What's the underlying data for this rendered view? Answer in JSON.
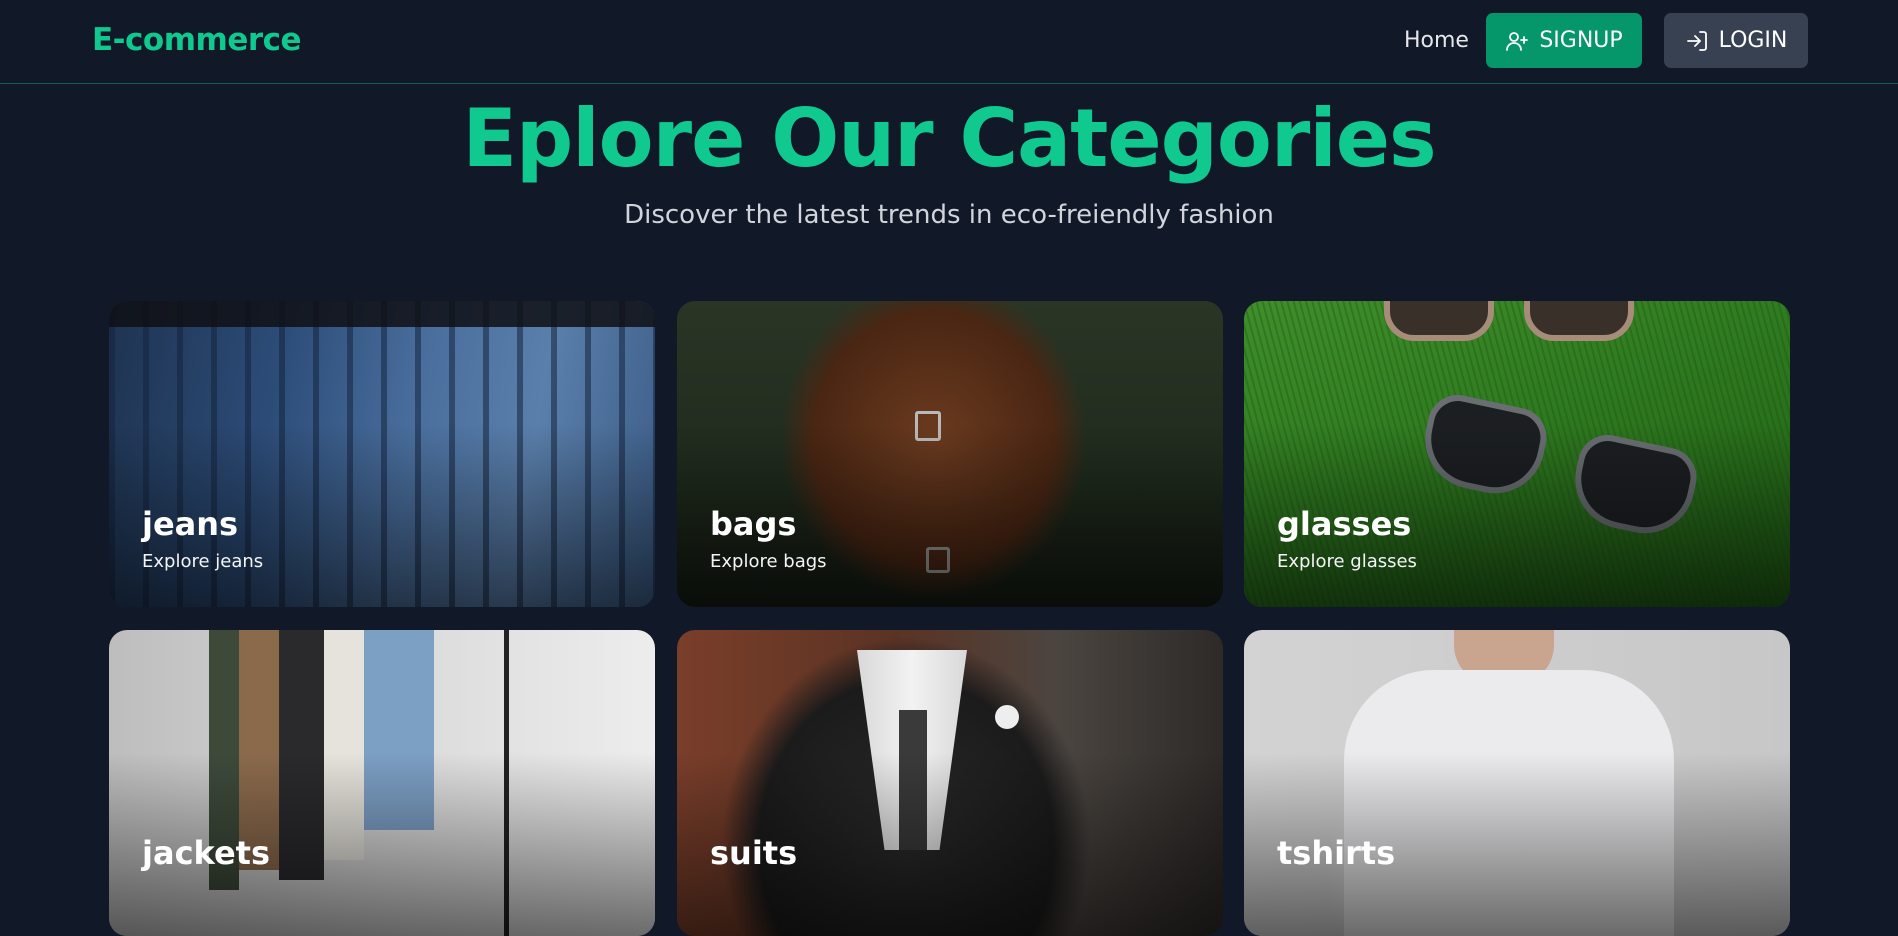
{
  "navbar": {
    "brand": "E-commerce",
    "home_label": "Home",
    "signup_label": "SIGNUP",
    "login_label": "LOGIN",
    "signup_icon": "user-plus-icon",
    "login_icon": "log-in-icon"
  },
  "hero": {
    "title": "Eplore Our Categories",
    "subtitle": "Discover the latest trends in eco-freiendly fashion"
  },
  "categories": [
    {
      "title": "jeans",
      "subtitle": "Explore jeans"
    },
    {
      "title": "bags",
      "subtitle": "Explore bags"
    },
    {
      "title": "glasses",
      "subtitle": "Explore glasses"
    },
    {
      "title": "jackets",
      "subtitle": ""
    },
    {
      "title": "suits",
      "subtitle": ""
    },
    {
      "title": "tshirts",
      "subtitle": ""
    }
  ],
  "colors": {
    "background": "#111827",
    "accent": "#10c98f",
    "signup_button": "#059669",
    "login_button": "#374151"
  }
}
